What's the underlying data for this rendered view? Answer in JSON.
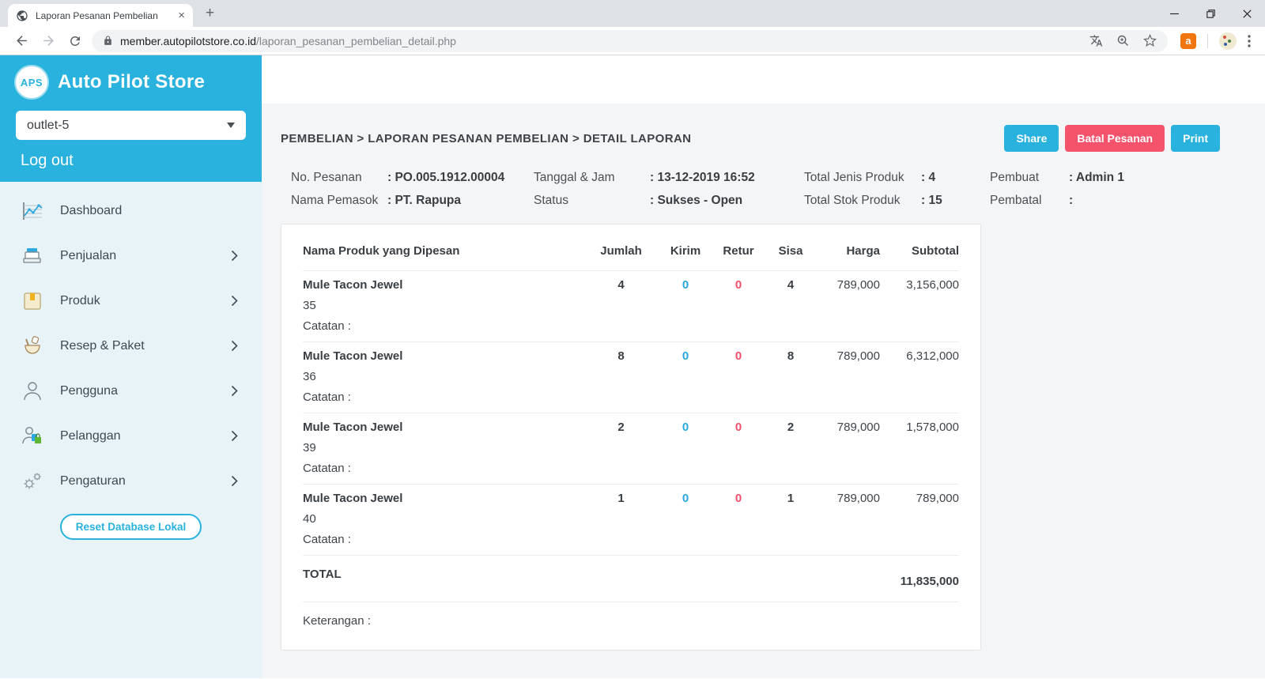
{
  "browser": {
    "tab_title": "Laporan Pesanan Pembelian",
    "tab_close": "×",
    "new_tab": "+",
    "url_domain": "member.autopilotstore.co.id",
    "url_path": "/laporan_pesanan_pembelian_detail.php",
    "extension_a_label": "a"
  },
  "sidebar": {
    "logo_text": "APS",
    "brand": "Auto Pilot Store",
    "outlet_selected": "outlet-5",
    "logout_label": "Log out",
    "items": [
      {
        "label": "Dashboard",
        "icon": "dashboard-icon",
        "has_submenu": false
      },
      {
        "label": "Penjualan",
        "icon": "sales-icon",
        "has_submenu": true
      },
      {
        "label": "Produk",
        "icon": "product-icon",
        "has_submenu": true
      },
      {
        "label": "Resep & Paket",
        "icon": "recipe-icon",
        "has_submenu": true
      },
      {
        "label": "Pengguna",
        "icon": "users-icon",
        "has_submenu": true
      },
      {
        "label": "Pelanggan",
        "icon": "customers-icon",
        "has_submenu": true
      },
      {
        "label": "Pengaturan",
        "icon": "settings-icon",
        "has_submenu": true
      }
    ],
    "reset_button": "Reset Database Lokal"
  },
  "page": {
    "breadcrumb": "PEMBELIAN > LAPORAN PESANAN PEMBELIAN > DETAIL LAPORAN",
    "actions": {
      "share": "Share",
      "cancel_order": "Batal Pesanan",
      "print": "Print"
    }
  },
  "order_info": {
    "no_pesanan_label": "No. Pesanan",
    "no_pesanan": ": PO.005.1912.00004",
    "nama_pemasok_label": "Nama Pemasok",
    "nama_pemasok": ": PT. Rapupa",
    "tanggal_label": "Tanggal & Jam",
    "tanggal": ": 13-12-2019 16:52",
    "status_label": "Status",
    "status": ": Sukses - Open",
    "total_jenis_label": "Total Jenis Produk",
    "total_jenis": ": 4",
    "total_stok_label": "Total Stok Produk",
    "total_stok": ": 15",
    "pembuat_label": "Pembuat",
    "pembuat": ": Admin 1",
    "pembatal_label": "Pembatal",
    "pembatal": ":"
  },
  "table": {
    "headers": {
      "name": "Nama Produk yang Dipesan",
      "jumlah": "Jumlah",
      "kirim": "Kirim",
      "retur": "Retur",
      "sisa": "Sisa",
      "harga": "Harga",
      "subtotal": "Subtotal"
    },
    "rows": [
      {
        "name": "Mule Tacon Jewel",
        "variant": "35",
        "catatan": "Catatan :",
        "jumlah": "4",
        "kirim": "0",
        "retur": "0",
        "sisa": "4",
        "harga": "789,000",
        "subtotal": "3,156,000"
      },
      {
        "name": "Mule Tacon Jewel",
        "variant": "36",
        "catatan": "Catatan :",
        "jumlah": "8",
        "kirim": "0",
        "retur": "0",
        "sisa": "8",
        "harga": "789,000",
        "subtotal": "6,312,000"
      },
      {
        "name": "Mule Tacon Jewel",
        "variant": "39",
        "catatan": "Catatan :",
        "jumlah": "2",
        "kirim": "0",
        "retur": "0",
        "sisa": "2",
        "harga": "789,000",
        "subtotal": "1,578,000"
      },
      {
        "name": "Mule Tacon Jewel",
        "variant": "40",
        "catatan": "Catatan :",
        "jumlah": "1",
        "kirim": "0",
        "retur": "0",
        "sisa": "1",
        "harga": "789,000",
        "subtotal": "789,000"
      }
    ],
    "total_label": "TOTAL",
    "total_value": "11,835,000",
    "keterangan_label": "Keterangan :"
  },
  "colors": {
    "accent": "#29b2de",
    "danger": "#f4536b",
    "kirim": "#29a8e0",
    "retur": "#f0506a"
  }
}
